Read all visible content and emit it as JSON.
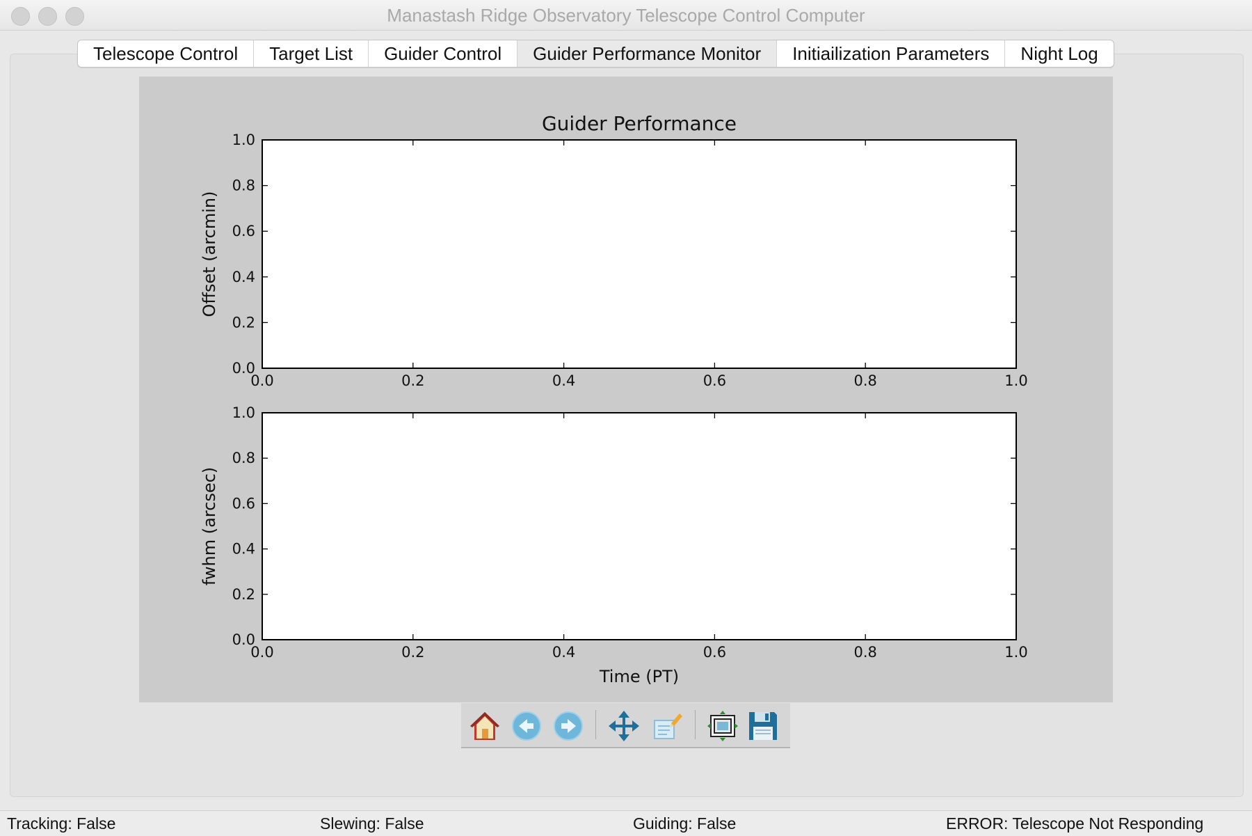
{
  "window": {
    "title": "Manastash Ridge Observatory Telescope Control Computer"
  },
  "tabs": [
    {
      "label": "Telescope Control"
    },
    {
      "label": "Target List"
    },
    {
      "label": "Guider Control"
    },
    {
      "label": "Guider Performance Monitor",
      "active": true
    },
    {
      "label": "Initiailization Parameters"
    },
    {
      "label": "Night Log"
    }
  ],
  "chart_data": [
    {
      "type": "line",
      "title": "Guider Performance",
      "xlabel": "",
      "ylabel": "Offset (arcmin)",
      "xlim": [
        0.0,
        1.0
      ],
      "ylim": [
        0.0,
        1.0
      ],
      "x_ticks": [
        "0.0",
        "0.2",
        "0.4",
        "0.6",
        "0.8",
        "1.0"
      ],
      "y_ticks": [
        "0.0",
        "0.2",
        "0.4",
        "0.6",
        "0.8",
        "1.0"
      ],
      "series": [],
      "grid": false
    },
    {
      "type": "line",
      "title": "",
      "xlabel": "Time (PT)",
      "ylabel": "fwhm (arcsec)",
      "xlim": [
        0.0,
        1.0
      ],
      "ylim": [
        0.0,
        1.0
      ],
      "x_ticks": [
        "0.0",
        "0.2",
        "0.4",
        "0.6",
        "0.8",
        "1.0"
      ],
      "y_ticks": [
        "0.0",
        "0.2",
        "0.4",
        "0.6",
        "0.8",
        "1.0"
      ],
      "series": [],
      "grid": false
    }
  ],
  "toolbar": {
    "buttons": [
      {
        "icon": "home-icon"
      },
      {
        "icon": "back-arrow-icon"
      },
      {
        "icon": "forward-arrow-icon"
      },
      {
        "icon": "pan-move-icon"
      },
      {
        "icon": "zoom-rect-icon"
      },
      {
        "icon": "subplots-config-icon"
      },
      {
        "icon": "save-floppy-icon"
      }
    ]
  },
  "status": {
    "tracking": "Tracking: False",
    "slewing": "Slewing: False",
    "guiding": "Guiding: False",
    "error": "ERROR: Telescope Not Responding"
  },
  "colors": {
    "figure_bg": "#cbcbcb",
    "axes_bg": "#ffffff",
    "home_icon": "#c0392b",
    "nav_arrow_icon": "#6fb7da",
    "floppy_icon": "#1f6f9a"
  }
}
